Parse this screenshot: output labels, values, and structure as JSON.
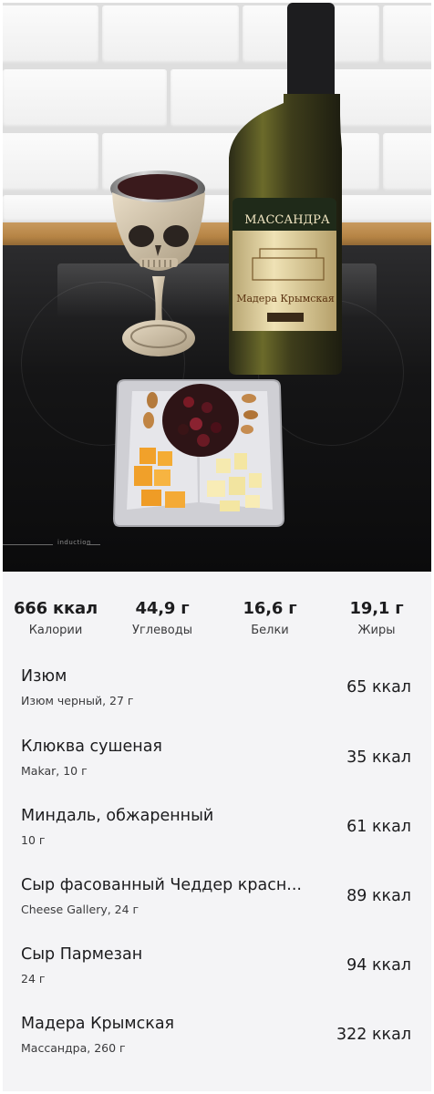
{
  "summary": {
    "calories": {
      "value": "666 ккал",
      "label": "Калории"
    },
    "carbs": {
      "value": "44,9 г",
      "label": "Углеводы"
    },
    "protein": {
      "value": "16,6 г",
      "label": "Белки"
    },
    "fat": {
      "value": "19,1 г",
      "label": "Жиры"
    }
  },
  "photo": {
    "bottle_brand": "МАССАНДРА",
    "bottle_label": "Мадера Крымская",
    "cooktop_label": "induction"
  },
  "items": [
    {
      "name": "Изюм",
      "detail": "Изюм черный, 27 г",
      "kcal": "65 ккал"
    },
    {
      "name": "Клюква сушеная",
      "detail": "Makar, 10 г",
      "kcal": "35 ккал"
    },
    {
      "name": "Миндаль, обжаренный",
      "detail": "10 г",
      "kcal": "61 ккал"
    },
    {
      "name": "Сыр фасованный Чеддер красн...",
      "detail": "Cheese Gallery, 24 г",
      "kcal": "89 ккал"
    },
    {
      "name": "Сыр Пармезан",
      "detail": "24 г",
      "kcal": "94 ккал"
    },
    {
      "name": "Мадера Крымская",
      "detail": "Массандра, 260 г",
      "kcal": "322 ккал"
    }
  ]
}
